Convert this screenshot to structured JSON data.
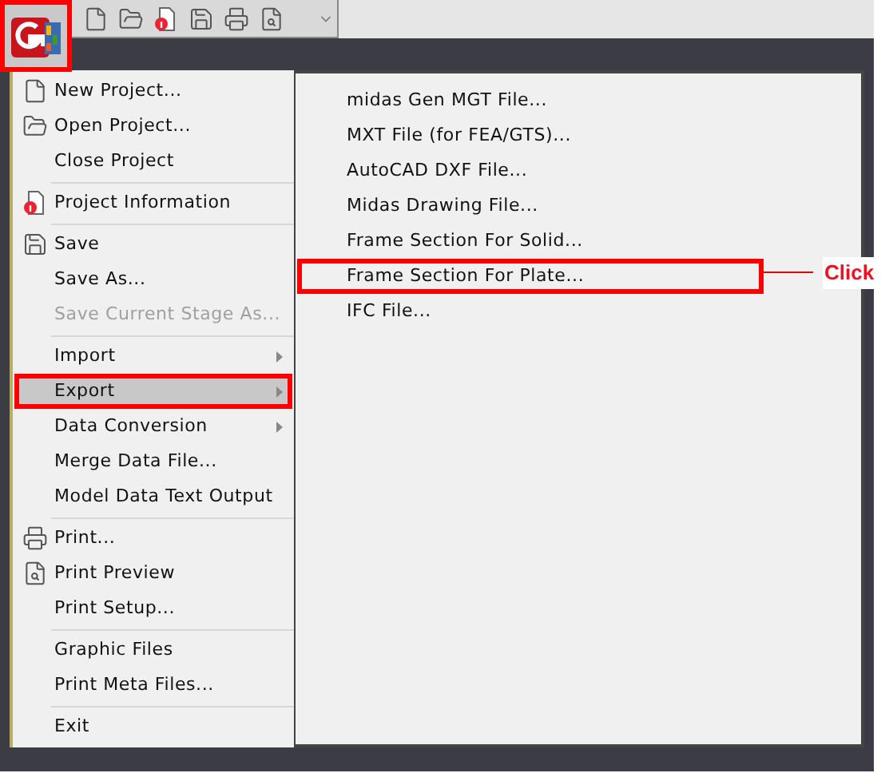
{
  "app_button": {
    "kind": "logo"
  },
  "toolbar": {
    "icons": [
      {
        "kind": "new"
      },
      {
        "kind": "open"
      },
      {
        "kind": "info"
      },
      {
        "kind": "save"
      },
      {
        "kind": "print"
      },
      {
        "kind": "preview"
      },
      {
        "kind": "more"
      }
    ]
  },
  "menu": {
    "items": [
      {
        "kind": "new",
        "label": "New Project...",
        "disabled": false,
        "submenu": false,
        "selected": false
      },
      {
        "kind": "open",
        "label": "Open Project...",
        "disabled": false,
        "submenu": false,
        "selected": false
      },
      {
        "kind": "item",
        "label": "Close Project",
        "disabled": false,
        "submenu": false,
        "selected": false
      },
      {
        "kind": "separator"
      },
      {
        "kind": "info",
        "label": "Project Information",
        "disabled": false,
        "submenu": false,
        "selected": false
      },
      {
        "kind": "separator"
      },
      {
        "kind": "save",
        "label": "Save",
        "disabled": false,
        "submenu": false,
        "selected": false
      },
      {
        "kind": "item",
        "label": "Save As...",
        "disabled": false,
        "submenu": false,
        "selected": false
      },
      {
        "kind": "item",
        "label": "Save Current Stage As...",
        "disabled": true,
        "submenu": false,
        "selected": false
      },
      {
        "kind": "separator"
      },
      {
        "kind": "item",
        "label": "Import",
        "disabled": false,
        "submenu": true,
        "selected": false
      },
      {
        "kind": "item",
        "label": "Export",
        "disabled": false,
        "submenu": true,
        "selected": true
      },
      {
        "kind": "item",
        "label": "Data Conversion",
        "disabled": false,
        "submenu": true,
        "selected": false
      },
      {
        "kind": "item",
        "label": "Merge Data File...",
        "disabled": false,
        "submenu": false,
        "selected": false
      },
      {
        "kind": "item",
        "label": "Model Data Text Output",
        "disabled": false,
        "submenu": false,
        "selected": false
      },
      {
        "kind": "separator"
      },
      {
        "kind": "print",
        "label": "Print...",
        "disabled": false,
        "submenu": false,
        "selected": false
      },
      {
        "kind": "preview",
        "label": "Print Preview",
        "disabled": false,
        "submenu": false,
        "selected": false
      },
      {
        "kind": "item",
        "label": "Print Setup...",
        "disabled": false,
        "submenu": false,
        "selected": false
      },
      {
        "kind": "separator"
      },
      {
        "kind": "item",
        "label": "Graphic Files",
        "disabled": false,
        "submenu": false,
        "selected": false
      },
      {
        "kind": "item",
        "label": "Print Meta Files...",
        "disabled": false,
        "submenu": false,
        "selected": false
      },
      {
        "kind": "separator"
      },
      {
        "kind": "item",
        "label": "Exit",
        "disabled": false,
        "submenu": false,
        "selected": false
      }
    ]
  },
  "submenu": {
    "items": [
      {
        "label": "midas Gen MGT File...",
        "selected": false
      },
      {
        "label": "MXT File (for FEA/GTS)...",
        "selected": false
      },
      {
        "label": "AutoCAD DXF File...",
        "selected": false
      },
      {
        "label": "Midas Drawing File...",
        "selected": false
      },
      {
        "label": "Frame Section For Solid...",
        "selected": false
      },
      {
        "label": "Frame Section For Plate...",
        "selected": true
      },
      {
        "label": "IFC File...",
        "selected": false
      }
    ]
  },
  "annotation": {
    "text": "Click"
  }
}
